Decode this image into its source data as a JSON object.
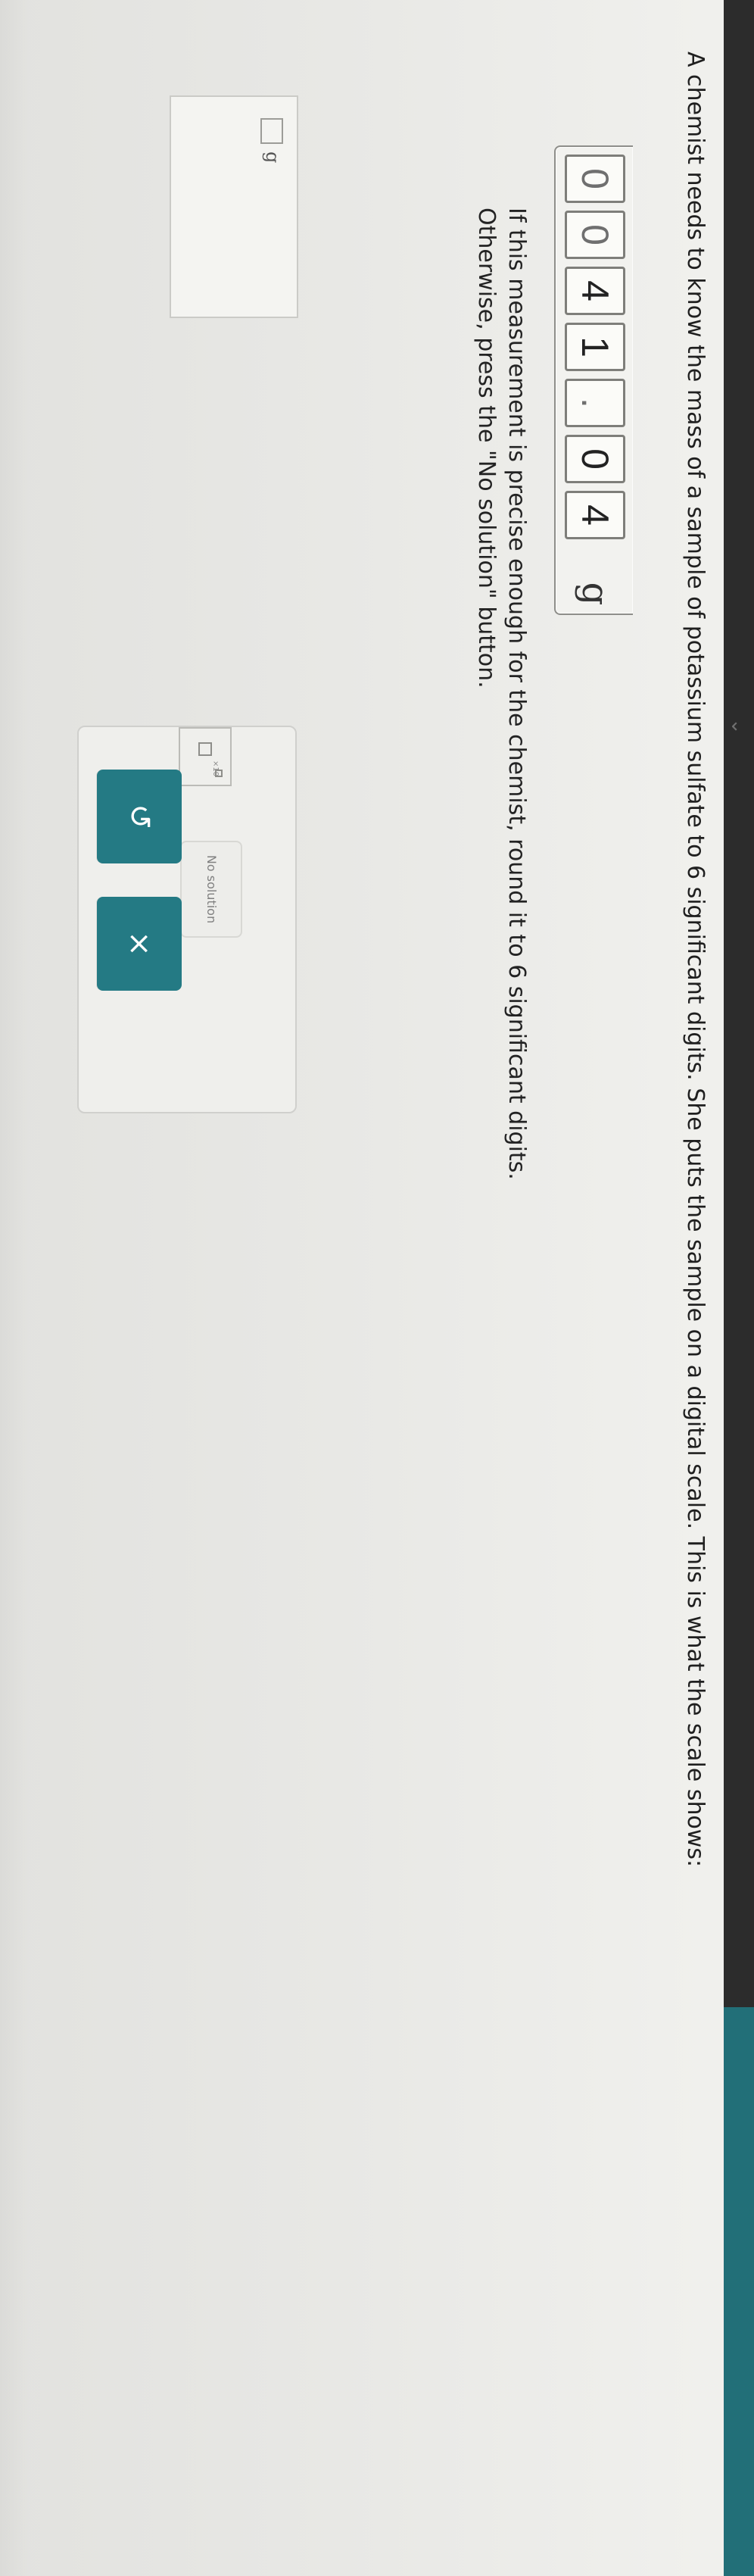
{
  "header": {
    "back_icon": "chevron-down-icon",
    "accent_color": "#226f78",
    "dark_bar_color": "#2c2c2c"
  },
  "question": {
    "text": "A chemist needs to know the mass of a sample of potassium sulfate to 6 significant digits. She puts the sample on a digital scale. This is what the scale shows:"
  },
  "scale": {
    "digits": [
      "0",
      "0",
      "4",
      "1",
      ".",
      "0",
      "4"
    ],
    "unit": "g"
  },
  "instructions": {
    "line1": "If this measurement is precise enough for the chemist, round it to 6 significant digits.",
    "line2": "Otherwise, press the \"No solution\" button."
  },
  "answer": {
    "unit": "g"
  },
  "tools": {
    "scientific_notation_label": "×10",
    "no_solution_label": "No solution",
    "undo_icon": "undo-icon",
    "clear_icon": "close-icon",
    "undo_symbol": "↺",
    "clear_symbol": "×"
  }
}
